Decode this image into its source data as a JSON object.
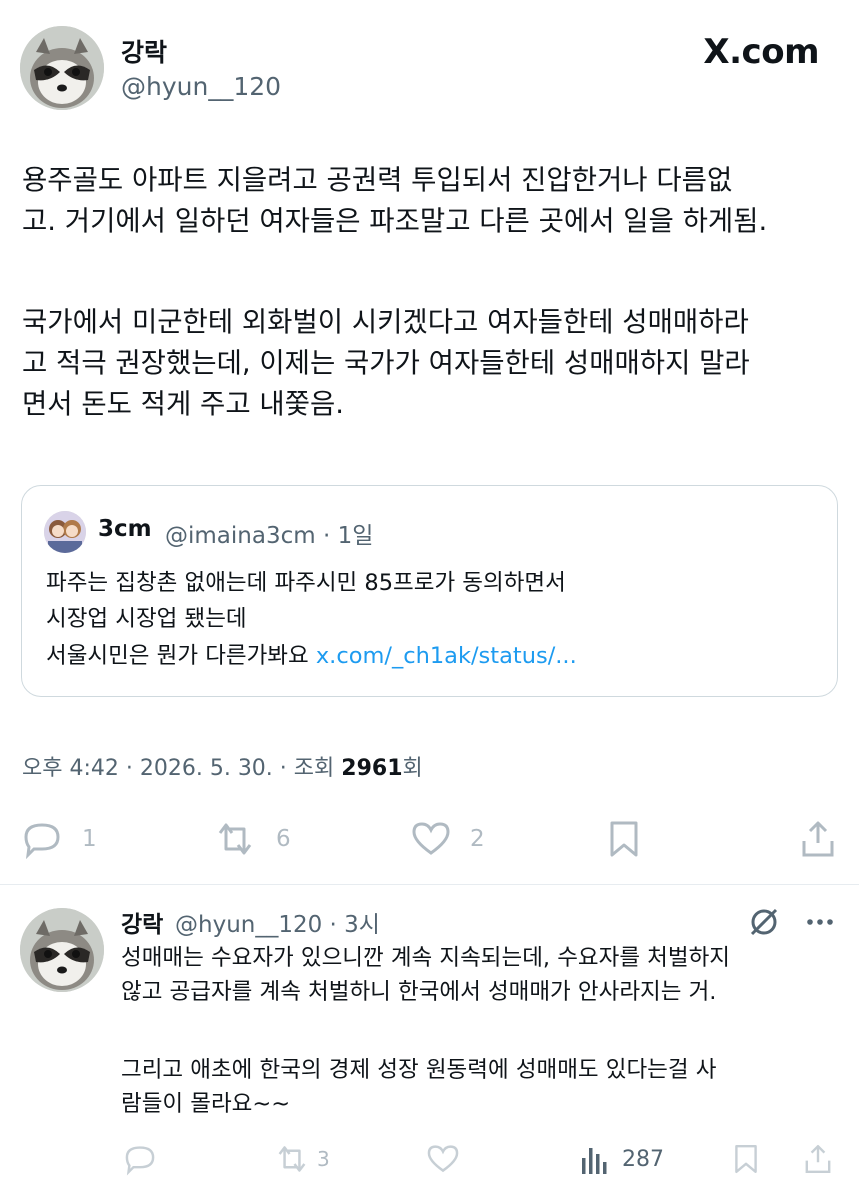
{
  "header": {
    "display_name": "강락",
    "handle": "@hyun__120",
    "site_logo": "X.com"
  },
  "tweet": {
    "paragraph1": [
      "용주골도 아파트 지을려고 공권력 투입되서 진압한거나 다름없",
      "고. 거기에서 일하던 여자들은 파조말고 다른 곳에서 일을 하게됨."
    ],
    "paragraph2": [
      "국가에서 미군한테 외화벌이 시키겠다고 여자들한테 성매매하라",
      "고 적극 권장했는데, 이제는 국가가 여자들한테 성매매하지 말라",
      "면서 돈도 적게 주고 내쫓음."
    ]
  },
  "quoted": {
    "display_name": "3cm",
    "handle_time": "@imaina3cm · 1일",
    "lines": [
      "파주는 집창촌 없애는데 파주시민 85프로가 동의하면서",
      "시장업 시장업 됐는데"
    ],
    "last_line": "서울시민은 뭔가 다른가봐요 ",
    "link": "x.com/_ch1ak/status/..."
  },
  "meta": {
    "time_date": "오후 4:42 · 2026. 5. 30. · 조회 ",
    "views": "2961",
    "views_suffix": "회"
  },
  "actions": {
    "replies": "1",
    "reposts": "6",
    "likes": "2"
  },
  "reply": {
    "display_name": "강락",
    "handle_time": "@hyun__120 · 3시",
    "paragraph1": [
      "성매매는 수요자가 있으니깐 계속 지속되는데, 수요자를 처벌하지",
      "않고 공급자를 계속 처벌하니 한국에서 성매매가 안사라지는 거."
    ],
    "paragraph2": [
      "그리고 애초에 한국의 경제 성장 원동력에 성매매도 있다는걸 사",
      "람들이 몰라요~~"
    ],
    "actions": {
      "replies": "",
      "reposts": "3",
      "likes": "",
      "views": "287"
    }
  },
  "colors": {
    "text": "#0f1419",
    "secondary": "#536471",
    "link": "#1d9bf0",
    "border": "#cfd9de"
  }
}
